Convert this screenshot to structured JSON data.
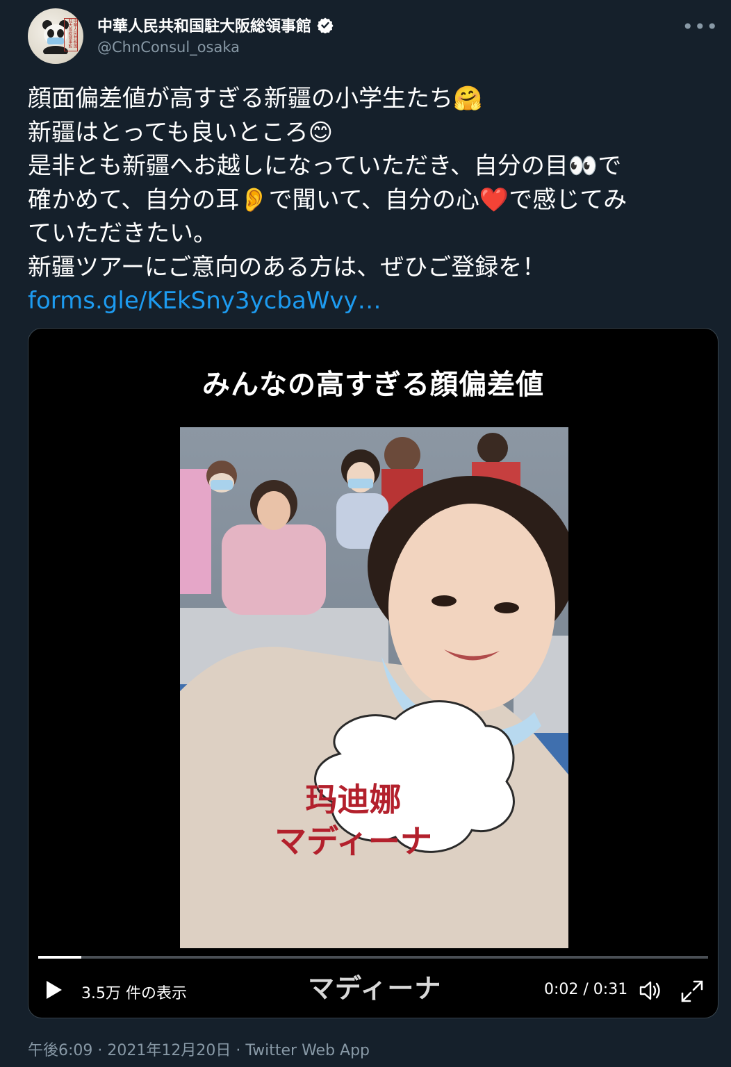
{
  "account": {
    "display_name": "中華人民共和国駐大阪総領事館",
    "handle": "@ChnConsul_osaka",
    "verified": true,
    "more_icon": "more-horizontal-icon",
    "avatar_seal_text": "中華人民共和国駐大阪総領事館"
  },
  "tweet": {
    "lines": [
      "顔面偏差値が高すぎる新疆の小学生たち🤗",
      "新疆はとっても良いところ😊",
      "是非とも新疆へお越しになっていただき、自分の目👀で",
      "確かめて、自分の耳👂で聞いて、自分の心❤️で感じてみ",
      "ていただきたい。",
      "新疆ツアーにご意向のある方は、ぜひご登録を！"
    ],
    "link": "forms.gle/KEkSny3ycbaWvy…"
  },
  "video": {
    "title_overlay": "みんなの高すぎる顔偏差値",
    "name_bubble_line1": "玛迪娜",
    "name_bubble_line2": "マディーナ",
    "subtitle": "マディーナ",
    "views": "3.5万 件の表示",
    "time": "0:02 / 0:31",
    "progress_fraction": 0.0645,
    "play_icon": "play-icon",
    "volume_icon": "volume-icon",
    "fullscreen_icon": "fullscreen-icon"
  },
  "meta": {
    "time": "午後6:09",
    "date": "2021年12月20日",
    "source": "Twitter Web App",
    "separator": " · "
  },
  "colors": {
    "background": "#15202b",
    "link": "#1d9bf0",
    "secondary_text": "#8899a6",
    "verified": "#ffffff",
    "bubble_text": "#b3202c"
  }
}
